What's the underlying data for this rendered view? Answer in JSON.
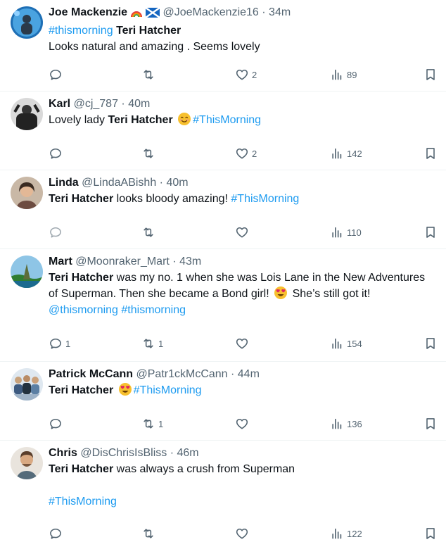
{
  "tweets": [
    {
      "name": "Joe Mackenzie",
      "handle": "@JoeMackenzie16",
      "time": "34m",
      "line1": {
        "tag": "#thismorning",
        "bold": "Teri Hatcher"
      },
      "line2": "Looks natural and amazing . Seems lovely",
      "replies": "",
      "retweets": "",
      "likes": "2",
      "views": "89"
    },
    {
      "name": "Karl",
      "handle": "@cj_787",
      "time": "40m",
      "line1": {
        "pre": "Lovely lady ",
        "bold": "Teri Hatcher",
        "emoji": "smiling-face",
        "tag": "#ThisMorning"
      },
      "replies": "",
      "retweets": "",
      "likes": "2",
      "views": "142"
    },
    {
      "name": "Linda",
      "handle": "@LindaABishh",
      "time": "40m",
      "line1": {
        "bold": "Teri Hatcher",
        "post": " looks bloody amazing!  ",
        "tag": "#ThisMorning"
      },
      "replies": "",
      "retweets": "",
      "likes": "",
      "views": "110"
    },
    {
      "name": "Mart",
      "handle": "@Moonraker_Mart",
      "time": "43m",
      "line1": {
        "bold": "Teri Hatcher",
        "post": " was my no. 1 when she was Lois Lane in the New Adventures"
      },
      "line2": {
        "pre": "of Superman. Then she became a Bond girl! ",
        "emoji": "heart-eyes",
        "post": " She’s still got it!"
      },
      "line3": {
        "tag1": "@thismorning",
        "tag2": "#thismorning"
      },
      "replies": "1",
      "retweets": "1",
      "likes": "",
      "views": "154"
    },
    {
      "name": "Patrick McCann",
      "handle": "@Patr1ckMcCann",
      "time": "44m",
      "line1": {
        "bold": "Teri Hatcher",
        "emoji": "heart-eyes",
        "tag": "#ThisMorning"
      },
      "replies": "",
      "retweets": "1",
      "likes": "",
      "views": "136"
    },
    {
      "name": "Chris",
      "handle": "@DisChrisIsBliss",
      "time": "46m",
      "line1": {
        "bold": "Teri Hatcher",
        "post": " was always a crush from Superman"
      },
      "line3": {
        "tag": "#ThisMorning"
      },
      "replies": "",
      "retweets": "",
      "likes": "",
      "views": "122"
    }
  ],
  "separator": " · ",
  "colors": {
    "link": "#1d9bf0",
    "muted": "#536471",
    "text": "#0f1419",
    "divider": "#eff3f4"
  },
  "icons": [
    "reply-icon",
    "retweet-icon",
    "like-icon",
    "views-icon",
    "bookmark-icon",
    "rainbow-emoji",
    "scotland-flag",
    "smiling-face-emoji",
    "heart-eyes-emoji"
  ]
}
